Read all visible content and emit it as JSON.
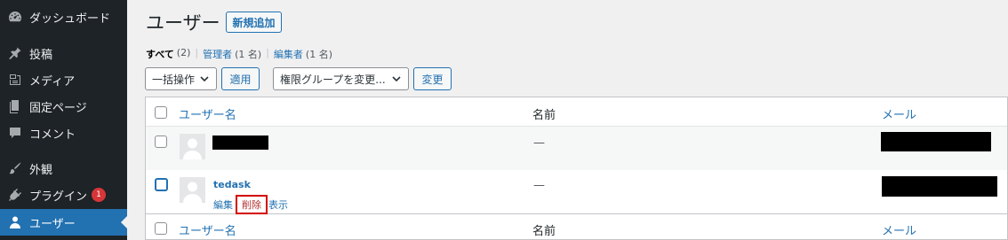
{
  "sidebar": {
    "items": [
      {
        "label": "ダッシュボード",
        "icon": "dashboard-icon",
        "current": false
      },
      {
        "label": "投稿",
        "icon": "pin-icon",
        "current": false
      },
      {
        "label": "メディア",
        "icon": "media-icon",
        "current": false
      },
      {
        "label": "固定ページ",
        "icon": "page-icon",
        "current": false
      },
      {
        "label": "コメント",
        "icon": "comment-icon",
        "current": false
      },
      {
        "label": "外観",
        "icon": "brush-icon",
        "current": false
      },
      {
        "label": "プラグイン",
        "icon": "plugin-icon",
        "current": false,
        "badge": "1"
      },
      {
        "label": "ユーザー",
        "icon": "user-icon",
        "current": true
      }
    ]
  },
  "header": {
    "title": "ユーザー",
    "add_new": "新規追加"
  },
  "filters": {
    "all_label": "すべて",
    "all_count": "(2)",
    "admin_label": "管理者",
    "admin_count": "(1 名)",
    "editor_label": "編集者",
    "editor_count": "(1 名)"
  },
  "bulk": {
    "select_value": "一括操作",
    "apply": "適用",
    "role_value": "権限グループを変更...",
    "change": "変更"
  },
  "table": {
    "columns": {
      "username": "ユーザー名",
      "name": "名前",
      "email": "メール"
    },
    "rows": [
      {
        "username": "",
        "name": "—",
        "email": ""
      },
      {
        "username": "tedask",
        "name": "—",
        "email": "",
        "actions": {
          "edit": "編集",
          "delete": "削除",
          "view": "表示"
        }
      }
    ]
  },
  "colors": {
    "sidebar_bg": "#1d2327",
    "accent": "#2271b1",
    "delete_highlight": "#d40000",
    "badge": "#d63638"
  }
}
